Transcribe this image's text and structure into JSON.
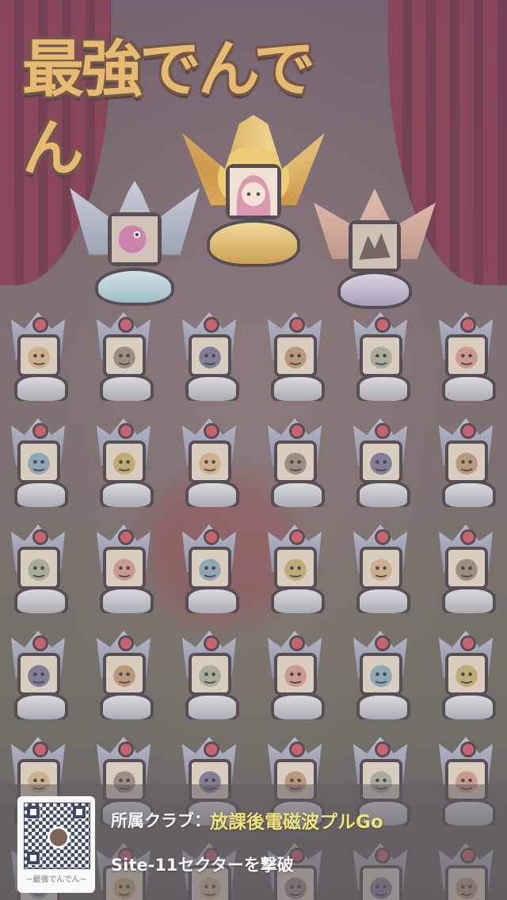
{
  "game": {
    "logo_text": "最強でんでん"
  },
  "podiums": [
    {
      "rank": "silver",
      "character": "pink-dinosaur"
    },
    {
      "rank": "gold",
      "character": "pink-haired-girl"
    },
    {
      "rank": "bronze",
      "character": "dark-creature"
    }
  ],
  "trophies": [
    {
      "character": "long-haired-girl"
    },
    {
      "character": "black-cat"
    },
    {
      "character": "shadow-blob"
    },
    {
      "character": "spaceship"
    },
    {
      "character": "gray-robot"
    },
    {
      "character": "blue-orb"
    },
    {
      "character": "goggles-warrior"
    },
    {
      "character": "orange-blob"
    },
    {
      "character": "hooded-figure"
    },
    {
      "character": "curly-haired-girl"
    },
    {
      "character": "brown-haired-boy"
    },
    {
      "character": "blonde-girl"
    },
    {
      "character": "green-monster"
    },
    {
      "character": "purple-wizard"
    },
    {
      "character": "white-haired-girl"
    },
    {
      "character": "dark-creature"
    },
    {
      "character": "dark-creature"
    },
    {
      "character": "yellow-lizard"
    },
    {
      "character": "angry-man"
    },
    {
      "character": "old-man"
    },
    {
      "character": "golden-warrior"
    },
    {
      "character": "white-robot"
    },
    {
      "character": "blue-dragon"
    },
    {
      "character": "orange-blob"
    },
    {
      "character": "gray-creature"
    },
    {
      "character": "green-frog"
    },
    {
      "character": "sunglasses-boy"
    },
    {
      "character": "white-machine"
    },
    {
      "character": "red-haired-girl"
    },
    {
      "character": "blue-haired-girl"
    },
    {
      "character": "hidden"
    },
    {
      "character": "hidden"
    },
    {
      "character": "hidden"
    },
    {
      "character": "hidden"
    },
    {
      "character": "orange-haired-girl"
    },
    {
      "character": "eyeball"
    }
  ],
  "footer": {
    "qr_caption": "~最強でんでん~",
    "club_label": "所属クラブ：",
    "club_name": "放課後電磁波プルGo",
    "achievement": "Site-11セクターを撃破"
  },
  "colors": {
    "gold": "#e6b24a",
    "silver": "#9ea4b8",
    "bronze": "#c99a88",
    "club_name": "#f3e36a"
  }
}
